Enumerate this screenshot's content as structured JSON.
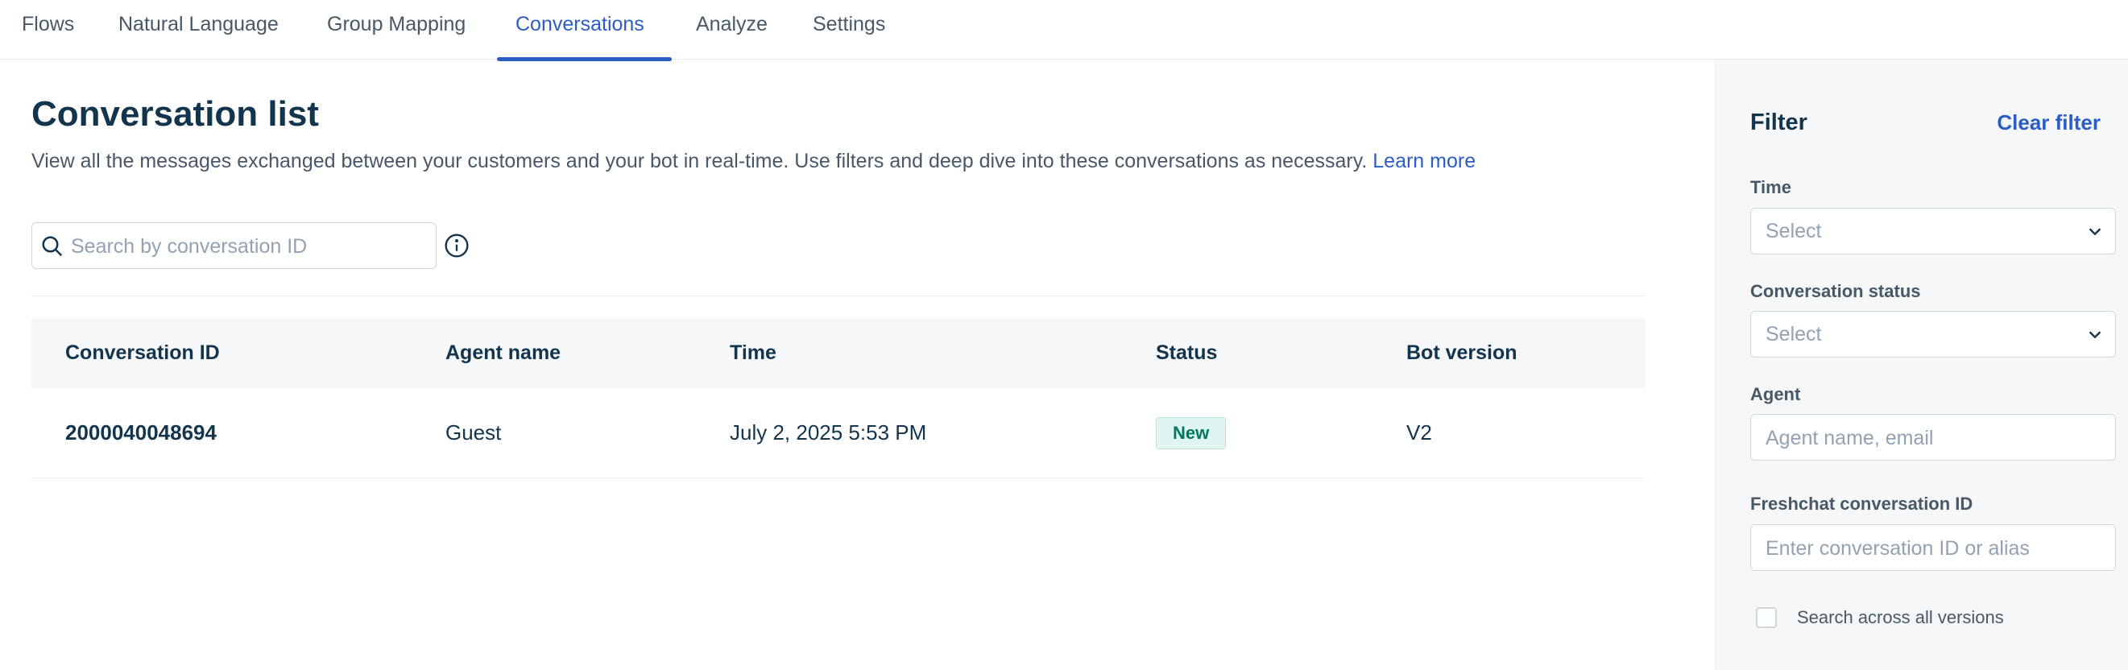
{
  "nav": {
    "tabs": [
      {
        "label": "Flows",
        "active": false
      },
      {
        "label": "Natural Language",
        "active": false
      },
      {
        "label": "Group Mapping",
        "active": false
      },
      {
        "label": "Conversations",
        "active": true
      },
      {
        "label": "Analyze",
        "active": false
      },
      {
        "label": "Settings",
        "active": false
      }
    ]
  },
  "main": {
    "title": "Conversation list",
    "description": "View all the messages exchanged between your customers and your bot in real-time. Use filters and deep dive into these conversations as necessary.",
    "learn_more": "Learn more",
    "search": {
      "placeholder": "Search by conversation ID",
      "value": ""
    },
    "table": {
      "columns": [
        "Conversation ID",
        "Agent name",
        "Time",
        "Status",
        "Bot version"
      ],
      "rows": [
        {
          "conversation_id": "2000040048694",
          "agent_name": "Guest",
          "time": "July 2, 2025 5:53 PM",
          "status": "New",
          "bot_version": "V2"
        }
      ]
    }
  },
  "filter": {
    "title": "Filter",
    "clear_label": "Clear filter",
    "time": {
      "label": "Time",
      "value": "Select"
    },
    "status": {
      "label": "Conversation status",
      "value": "Select"
    },
    "agent": {
      "label": "Agent",
      "placeholder": "Agent name, email",
      "value": ""
    },
    "freshchat": {
      "label": "Freshchat conversation ID",
      "placeholder": "Enter conversation ID or alias",
      "value": ""
    },
    "all_versions": {
      "label": "Search across all versions",
      "checked": false
    }
  },
  "colors": {
    "accent": "#2c5cc5",
    "text": "#12344d",
    "muted": "#475867",
    "status_new_bg": "#e0f5f1",
    "status_new_text": "#00795b"
  }
}
